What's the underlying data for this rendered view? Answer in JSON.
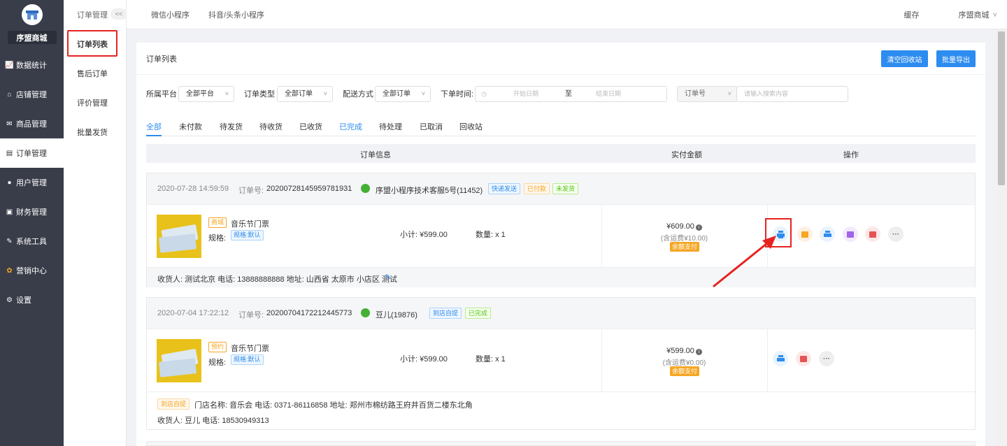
{
  "sidebar": {
    "brand": "序盟商城",
    "items": [
      {
        "label": "数据统计",
        "icon": "chart-icon"
      },
      {
        "label": "店铺管理",
        "icon": "shop-icon"
      },
      {
        "label": "商品管理",
        "icon": "goods-icon"
      },
      {
        "label": "订单管理",
        "icon": "order-icon"
      },
      {
        "label": "用户管理",
        "icon": "user-icon"
      },
      {
        "label": "财务管理",
        "icon": "finance-icon"
      },
      {
        "label": "系统工具",
        "icon": "wrench-icon"
      },
      {
        "label": "营销中心",
        "icon": "marketing-icon"
      },
      {
        "label": "设置",
        "icon": "gear-icon"
      }
    ]
  },
  "subnav": {
    "title": "订单管理",
    "collapse": "<<",
    "items": [
      "订单列表",
      "售后订单",
      "评价管理",
      "批量发货"
    ]
  },
  "topbar": {
    "tabs": [
      "微信小程序",
      "抖音/头条小程序"
    ],
    "cache": "缓存",
    "user": "序盟商城"
  },
  "main": {
    "title": "订单列表",
    "btn_clear": "清空回收站",
    "btn_export": "批量导出"
  },
  "filters": {
    "platform_label": "所属平台",
    "platform_value": "全部平台",
    "type_label": "订单类型",
    "type_value": "全部订单",
    "delivery_label": "配送方式",
    "delivery_value": "全部订单",
    "time_label": "下单时间:",
    "start_placeholder": "开始日期",
    "to": "至",
    "end_placeholder": "结束日期",
    "search_type": "订单号",
    "search_placeholder": "请输入搜索内容"
  },
  "tabs": [
    "全部",
    "未付款",
    "待发货",
    "待收货",
    "已收货",
    "已完成",
    "待处理",
    "已取消",
    "回收站"
  ],
  "table_head": {
    "info": "订单信息",
    "amount": "实付金额",
    "action": "操作"
  },
  "orders": [
    {
      "time": "2020-07-28 14:59:59",
      "order_no_label": "订单号:",
      "order_no": "20200728145959781931",
      "customer": "序盟小程序技术客服5号(11452)",
      "tags": [
        "快递发送",
        "已付款",
        "未发货"
      ],
      "goods_tag": "商城",
      "goods_name": "音乐节门票",
      "spec_label": "规格:",
      "spec_value": "规格:默认",
      "subtotal": "小计: ¥599.00",
      "qty": "数量: x 1",
      "price": "¥609.00",
      "shipping": "(含运费¥10.00)",
      "pay": "余额支付",
      "footer": "收货人: 测试北京 电话: 13888888888 地址: 山西省 太原市 小店区 测试"
    },
    {
      "time": "2020-07-04 17:22:12",
      "order_no_label": "订单号:",
      "order_no": "20200704172212445773",
      "customer": "豆儿(19876)",
      "tags": [
        "到店自提",
        "已完成"
      ],
      "goods_tag": "预约",
      "goods_name": "音乐节门票",
      "spec_label": "规格:",
      "spec_value": "规格:默认",
      "subtotal": "小计: ¥599.00",
      "qty": "数量: x 1",
      "price": "¥599.00",
      "shipping": "(含运费¥0.00)",
      "pay": "余额支付",
      "pickup_tag": "到店自提",
      "store": "门店名称: 音乐会 电话: 0371-86116858 地址: 郑州市棉纺路王府井百货二楼东北角",
      "footer": "收货人: 豆儿 电话: 18530949313"
    }
  ]
}
